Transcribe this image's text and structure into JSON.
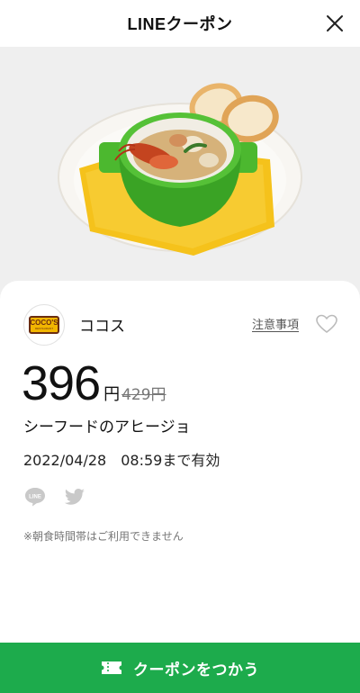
{
  "header": {
    "title": "LINEクーポン",
    "close_icon": "close-icon"
  },
  "hero": {
    "subject": "seafood ajillo in green pot with bread",
    "background": "#efefef"
  },
  "shop": {
    "name": "ココス",
    "logo_text": "COCO'S",
    "logo_subtext": "RESTAURANT",
    "notes_label": "注意事項",
    "favorite_icon": "heart-outline-icon"
  },
  "price": {
    "current": "396",
    "currency": "円",
    "original": "429円"
  },
  "product": {
    "name": "シーフードのアヒージョ"
  },
  "validity": {
    "text": "2022/04/28　08:59まで有効"
  },
  "share": {
    "icons": [
      "line-icon",
      "twitter-icon"
    ]
  },
  "notice": {
    "text": "※朝食時間帯はご利用できません"
  },
  "cta": {
    "label": "クーポンをつかう",
    "icon": "ticket-icon",
    "color": "#1dab4c"
  }
}
